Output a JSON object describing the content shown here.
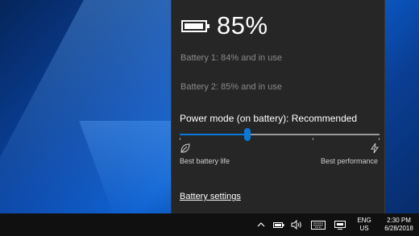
{
  "battery": {
    "percent": "85%",
    "details": [
      "Battery 1: 84% and in use",
      "Battery 2: 85% and in use"
    ]
  },
  "power_mode": {
    "label": "Power mode (on battery): Recommended",
    "slider_level_fraction": 0.34,
    "left_label": "Best battery life",
    "right_label": "Best performance"
  },
  "links": {
    "battery_settings": "Battery settings"
  },
  "taskbar": {
    "lang_line1": "ENG",
    "lang_line2": "US",
    "time": "2:30 PM",
    "date": "6/28/2018"
  },
  "colors": {
    "flyout_bg": "#262626",
    "accent": "#0a78d7",
    "taskbar_bg": "#101010"
  },
  "icons": {
    "battery_header": "battery-icon",
    "slider_left": "leaf-icon",
    "slider_right": "bolt-icon",
    "tray": [
      "chevron-up-icon",
      "battery-icon",
      "volume-icon",
      "keyboard-icon",
      "screen-icon"
    ]
  }
}
